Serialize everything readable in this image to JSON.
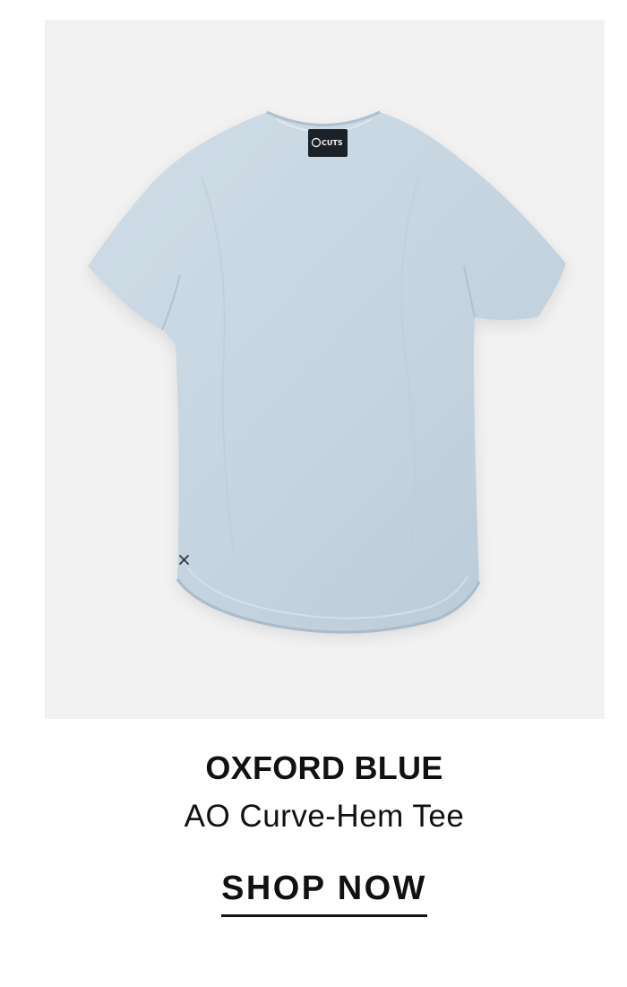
{
  "product": {
    "color_name": "OXFORD BLUE",
    "product_name": "AO Curve-Hem Tee",
    "cta_label": "SHOP NOW"
  },
  "image": {
    "brand_tag_text": "CUTS",
    "background_color": "#f2f2f2",
    "shirt_color": "#c8d7e2",
    "accent_icon": "x-logo-icon"
  }
}
